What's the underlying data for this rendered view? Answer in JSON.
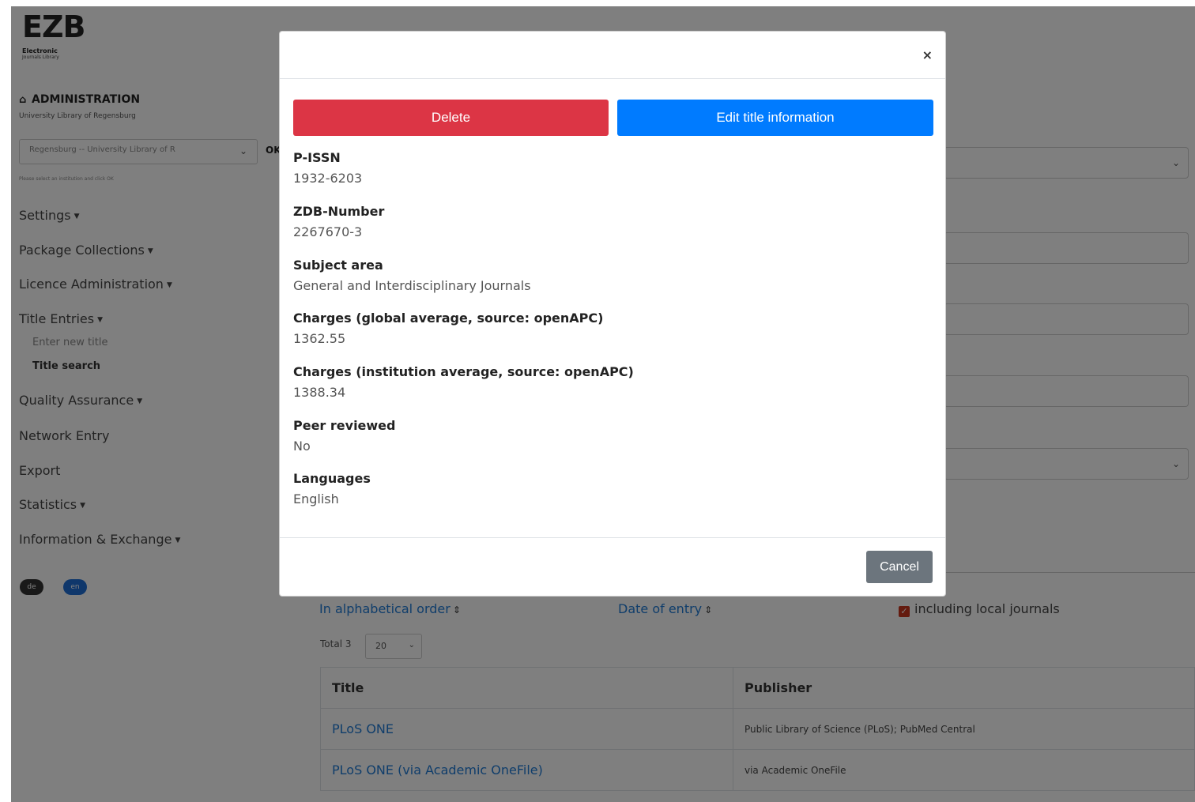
{
  "logo": {
    "mark": "EZB",
    "line1": "Electronic",
    "line2": "Journals Library"
  },
  "sidebar": {
    "heading": "ADMINISTRATION",
    "institution": "University Library of Regensburg",
    "institution_select": "Regensburg -- University Library of R",
    "ok_label": "OK",
    "hint": "Please select an institution and click OK",
    "nav": [
      {
        "label": "Settings",
        "caret": true
      },
      {
        "label": "Package Collections",
        "caret": true
      },
      {
        "label": "Licence Administration",
        "caret": true
      },
      {
        "label": "Title Entries",
        "caret": true
      },
      {
        "label": "Enter new title",
        "sub": true
      },
      {
        "label": "Title search",
        "sub": true,
        "active": true
      },
      {
        "label": "Quality Assurance",
        "caret": true
      },
      {
        "label": "Network Entry"
      },
      {
        "label": "Export"
      },
      {
        "label": "Statistics",
        "caret": true
      },
      {
        "label": "Information & Exchange",
        "caret": true
      }
    ],
    "languages": [
      "de",
      "en"
    ]
  },
  "results": {
    "sort_alpha": "In alphabetical order",
    "sort_date": "Date of entry",
    "include_local": "including local journals",
    "total_label": "Total",
    "total_count": "3",
    "per_page": "20",
    "columns": [
      "Title",
      "Publisher"
    ],
    "rows": [
      {
        "title": "PLoS ONE",
        "publisher": "Public Library of Science (PLoS); PubMed Central"
      },
      {
        "title": "PLoS ONE (via Academic OneFile)",
        "publisher": "via Academic OneFile"
      }
    ]
  },
  "modal": {
    "close_symbol": "×",
    "delete_label": "Delete",
    "edit_label": "Edit title information",
    "cancel_label": "Cancel",
    "fields": [
      {
        "label": "P-ISSN",
        "value": "1932-6203"
      },
      {
        "label": "ZDB-Number",
        "value": "2267670-3"
      },
      {
        "label": "Subject area",
        "value": "General and Interdisciplinary Journals"
      },
      {
        "label": "Charges (global average, source: openAPC)",
        "value": "1362.55"
      },
      {
        "label": "Charges (institution average, source: openAPC)",
        "value": "1388.34"
      },
      {
        "label": "Peer reviewed",
        "value": "No"
      },
      {
        "label": "Languages",
        "value": "English"
      }
    ]
  },
  "colors": {
    "danger": "#dc3545",
    "primary": "#007bff",
    "secondary": "#6c757d",
    "link": "#1f7bd6"
  }
}
